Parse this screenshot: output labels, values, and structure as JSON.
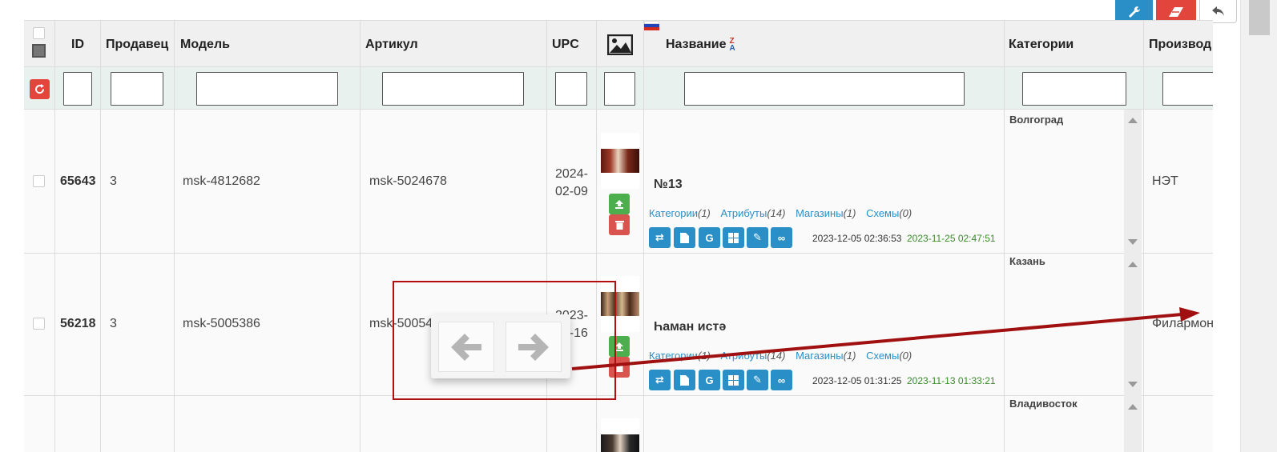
{
  "headers": {
    "id": "ID",
    "seller": "Продавец",
    "model": "Модель",
    "sku": "Артикул",
    "upc": "UPC",
    "name": "Название",
    "sort_icon": "sort-za-icon",
    "categories": "Категории",
    "manufacturer": "Производ"
  },
  "toolbar": {
    "wrench_icon": "wrench-icon",
    "eraser_icon": "eraser-icon",
    "undo_icon": "undo-icon",
    "colors": {
      "blue": "#2a8fc7",
      "red": "#e2453b"
    }
  },
  "rows": [
    {
      "id": "65643",
      "seller": "3",
      "model": "msk-4812682",
      "sku": "msk-5024678",
      "upc_line1": "2024-",
      "upc_line2": "02-09",
      "name": "№13",
      "link_categories": "Категории",
      "cnt_categories": "(1)",
      "link_attributes": "Атрибуты",
      "cnt_attributes": "(14)",
      "link_stores": "Магазины",
      "cnt_stores": "(1)",
      "link_schemes": "Схемы",
      "cnt_schemes": "(0)",
      "date_modified": "2023-12-05 02:36:53",
      "date_added": "2023-11-25 02:47:51",
      "category": "Волгоград",
      "manufacturer": "НЭТ"
    },
    {
      "id": "56218",
      "seller": "3",
      "model": "msk-5005386",
      "sku": "msk-5005473",
      "upc_line1": "2023-",
      "upc_line2": "12-16",
      "name": "Һаман истә",
      "link_categories": "Категории",
      "cnt_categories": "(1)",
      "link_attributes": "Атрибуты",
      "cnt_attributes": "(14)",
      "link_stores": "Магазины",
      "cnt_stores": "(1)",
      "link_schemes": "Схемы",
      "cnt_schemes": "(0)",
      "date_modified": "2023-12-05 01:31:25",
      "date_added": "2023-11-13 01:33:21",
      "category": "Казань",
      "manufacturer": "Филармон"
    },
    {
      "category": "Владивосток"
    }
  ],
  "nav_popup": {
    "prev_icon": "arrow-left-icon",
    "next_icon": "arrow-right-icon"
  }
}
